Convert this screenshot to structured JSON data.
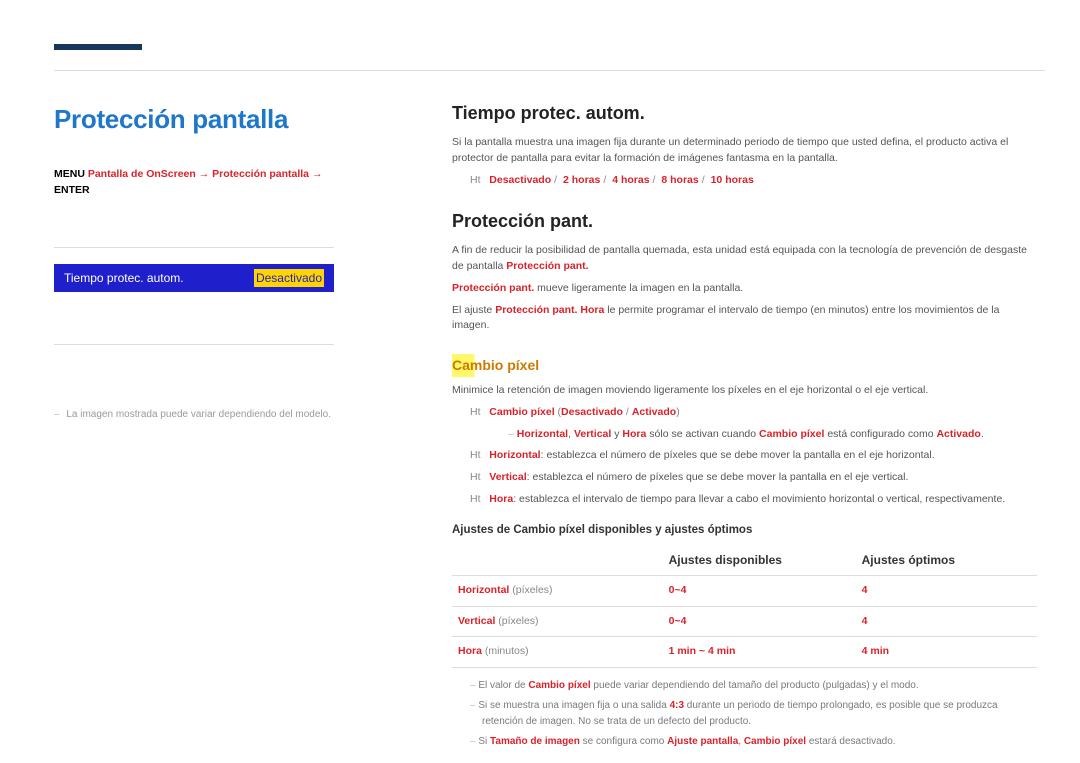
{
  "top": {
    "accent_color": "#17365d"
  },
  "sidebar": {
    "title": "Protección pantalla",
    "breadcrumb": {
      "menu": "MENU",
      "p1": "Pantalla de OnScreen",
      "p2": "Protección pantalla",
      "enter": "ENTER"
    },
    "option": {
      "label": "Tiempo protec. autom.",
      "value": "Desactivado"
    },
    "footnote": "La imagen mostrada puede variar dependiendo del modelo."
  },
  "main": {
    "sec1": {
      "heading": "Tiempo protec. autom.",
      "para": "Si la pantalla muestra una imagen fija durante un determinado periodo de tiempo que usted defina, el producto activa el protector de pantalla para evitar la formación de imágenes fantasma en la pantalla.",
      "opt_prefix": "Ht",
      "opts": [
        "Desactivado",
        "2 horas",
        "4 horas",
        "8 horas",
        "10 horas"
      ]
    },
    "sec2": {
      "heading": "Protección pant.",
      "para1a": "A fin de reducir la posibilidad de pantalla quemada, esta unidad está equipada con la tecnología de prevención de desgaste de pantalla ",
      "para1b": "Protección pant.",
      "para2a": "Protección pant.",
      "para2b": " mueve ligeramente la imagen en la pantalla.",
      "para3a": "El ajuste ",
      "para3b": "Protección pant. Hora",
      "para3c": " le permite programar el intervalo de tiempo (en minutos) entre los movimientos de la imagen.",
      "sub_heading": "Cambio píxel",
      "para4": "Minimice la retención de imagen moviendo ligeramente los píxeles en el eje horizontal o el eje vertical.",
      "bullets": [
        {
          "icon": "Ht",
          "label": "Cambio píxel",
          "tail_parts": [
            "Desactivado",
            "Activado"
          ]
        }
      ],
      "sub_note_a": "Horizontal",
      "sub_note_b": "Vertical",
      "sub_note_c": "Hora",
      "sub_note_mid1": " y ",
      "sub_note_mid2": " sólo se activan cuando ",
      "sub_note_d": "Cambio píxel",
      "sub_note_mid3": " está configurado como ",
      "sub_note_e": "Activado",
      "items": [
        {
          "icon": "Ht",
          "label": "Horizontal",
          "tail": ": establezca el número de píxeles que se debe mover la pantalla en el eje horizontal."
        },
        {
          "icon": "Ht",
          "label": "Vertical",
          "tail": ": establezca el número de píxeles que se debe mover la pantalla en el eje vertical."
        },
        {
          "icon": "Ht",
          "label": "Hora",
          "tail": ": establezca el intervalo de tiempo para llevar a cabo el movimiento horizontal o vertical, respectivamente."
        }
      ],
      "table_title": "Ajustes de Cambio píxel disponibles y ajustes óptimos",
      "table_headers": [
        "",
        "Ajustes disponibles",
        "Ajustes óptimos"
      ],
      "table_rows": [
        {
          "name": "Horizontal",
          "unit": "(píxeles)",
          "avail": "0~4",
          "opt": "4"
        },
        {
          "name": "Vertical",
          "unit": "(píxeles)",
          "avail": "0~4",
          "opt": "4"
        },
        {
          "name": "Hora",
          "unit": "(minutos)",
          "avail": "1 min ~ 4 min",
          "opt": "4 min"
        }
      ],
      "notes": [
        {
          "pre": "El valor de ",
          "b1": "Cambio píxel",
          "post": " puede variar dependiendo del tamaño del producto (pulgadas) y el modo."
        },
        {
          "pre": "Si se muestra una imagen fija o una salida ",
          "b1": "4:3",
          "post": " durante un periodo de tiempo prolongado, es posible que se produzca retención de imagen. No se trata de un defecto del producto."
        },
        {
          "pre": "Si ",
          "b1": "Tamaño de imagen",
          "mid1": " se configura como ",
          "b2": "Ajuste pantalla",
          "mid2": ", ",
          "b3": "Cambio píxel",
          "post": " estará desactivado."
        }
      ]
    }
  }
}
